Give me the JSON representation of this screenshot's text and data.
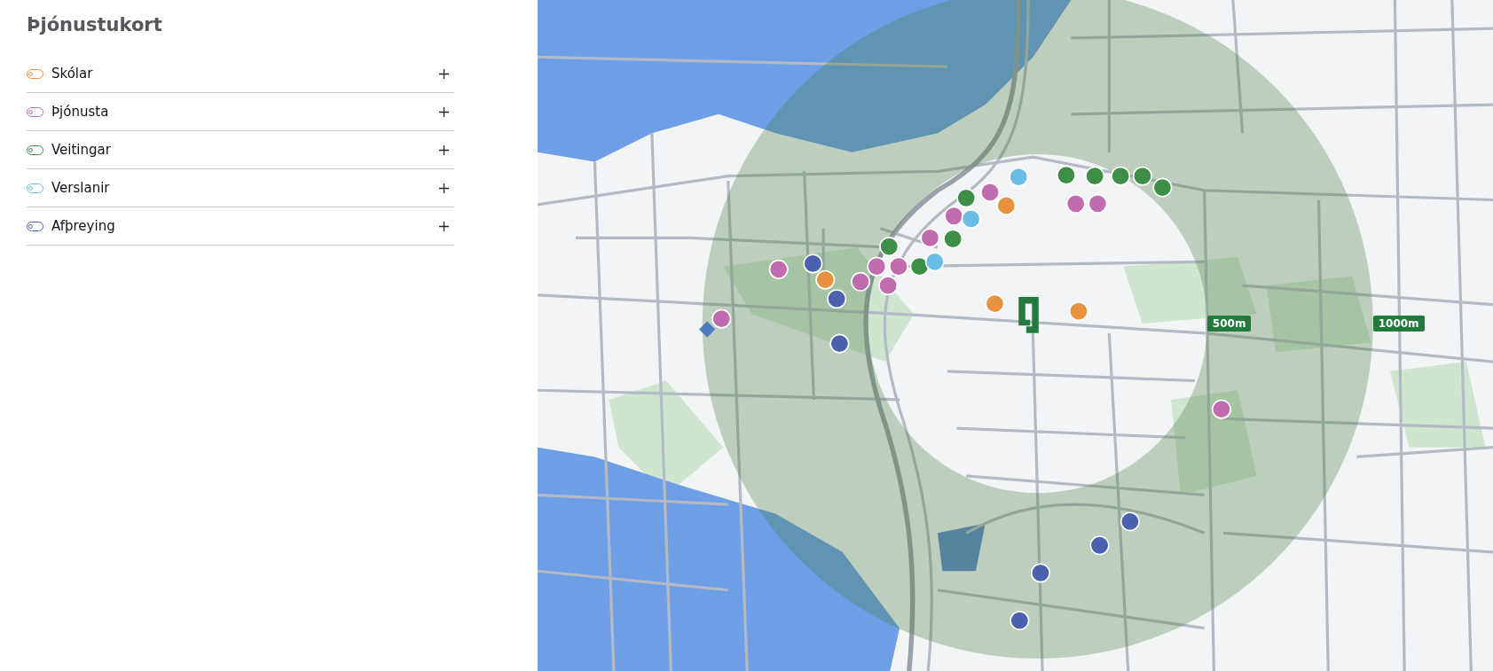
{
  "sidebar": {
    "title": "Þjónustukort",
    "categories": [
      {
        "label": "Skólar",
        "color": "#e8913f",
        "on": false
      },
      {
        "label": "Þjónusta",
        "color": "#c06cae",
        "on": false
      },
      {
        "label": "Veitingar",
        "color": "#3d8f47",
        "on": false
      },
      {
        "label": "Verslanir",
        "color": "#6bbde8",
        "on": false
      },
      {
        "label": "Afþreying",
        "color": "#4a62ad",
        "on": false
      }
    ]
  },
  "map": {
    "distance_labels": [
      "500m",
      "1000m"
    ]
  }
}
